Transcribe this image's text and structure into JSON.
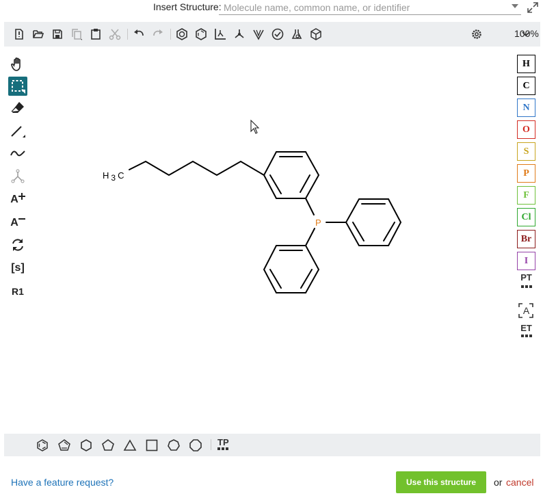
{
  "insert": {
    "label": "Insert Structure:",
    "placeholder": "Molecule name, common name, or identifier",
    "value": ""
  },
  "top_toolbar": {
    "icons": [
      "new-document-icon",
      "open-icon",
      "save-icon",
      "copy-icon",
      "paste-icon",
      "cut-icon",
      "undo-icon",
      "redo-icon",
      "aromatize-icon",
      "dearomatize-icon",
      "layout-icon",
      "clean-icon",
      "stereo-icon",
      "check-icon",
      "analyze-icon",
      "3d-view-icon",
      "settings-icon"
    ],
    "zoom": "100%"
  },
  "left_toolbar": {
    "tools": [
      "hand-tool",
      "select-tool",
      "eraser-tool",
      "bond-tool",
      "chain-tool",
      "charge-tool",
      "charge-plus-tool",
      "charge-minus-tool",
      "rotate-tool",
      "sgroup-tool",
      "rgroup-tool"
    ],
    "charge_plus_label": "A",
    "charge_minus_label": "A",
    "sgroup_label": "[s]",
    "rgroup_label": "R1",
    "active_tool": "select-tool",
    "accent_color": "#176e7c"
  },
  "right_toolbar": {
    "atoms": [
      {
        "symbol": "H",
        "color": "#000000"
      },
      {
        "symbol": "C",
        "color": "#000000"
      },
      {
        "symbol": "N",
        "color": "#3076c8"
      },
      {
        "symbol": "O",
        "color": "#d32a21"
      },
      {
        "symbol": "S",
        "color": "#c8a41e"
      },
      {
        "symbol": "P",
        "color": "#e07c1a"
      },
      {
        "symbol": "F",
        "color": "#6ec13a"
      },
      {
        "symbol": "Cl",
        "color": "#2fa82f"
      },
      {
        "symbol": "Br",
        "color": "#8b1a1a"
      },
      {
        "symbol": "I",
        "color": "#9542a8"
      }
    ],
    "periodic_table_label": "PT",
    "any_atom_label": "A",
    "extended_table_label": "ET"
  },
  "structure": {
    "methyl_label": "H",
    "methyl_sub": "3",
    "methyl_c": "C",
    "phosphorus_label": "P",
    "phosphorus_color": "#e07c1a"
  },
  "bottom_toolbar": {
    "templates": [
      "benzene-template",
      "cyclopentadiene-template",
      "cyclohexane-template",
      "cyclopentane-template",
      "cyclopropane-template",
      "cyclobutane-template",
      "cycloheptane-template",
      "cyclooctane-template"
    ],
    "template_library_label": "TP"
  },
  "footer": {
    "feature_request": "Have a feature request?",
    "use_button": "Use this structure",
    "or": "or",
    "cancel": "cancel",
    "use_button_color": "#72c12c"
  }
}
